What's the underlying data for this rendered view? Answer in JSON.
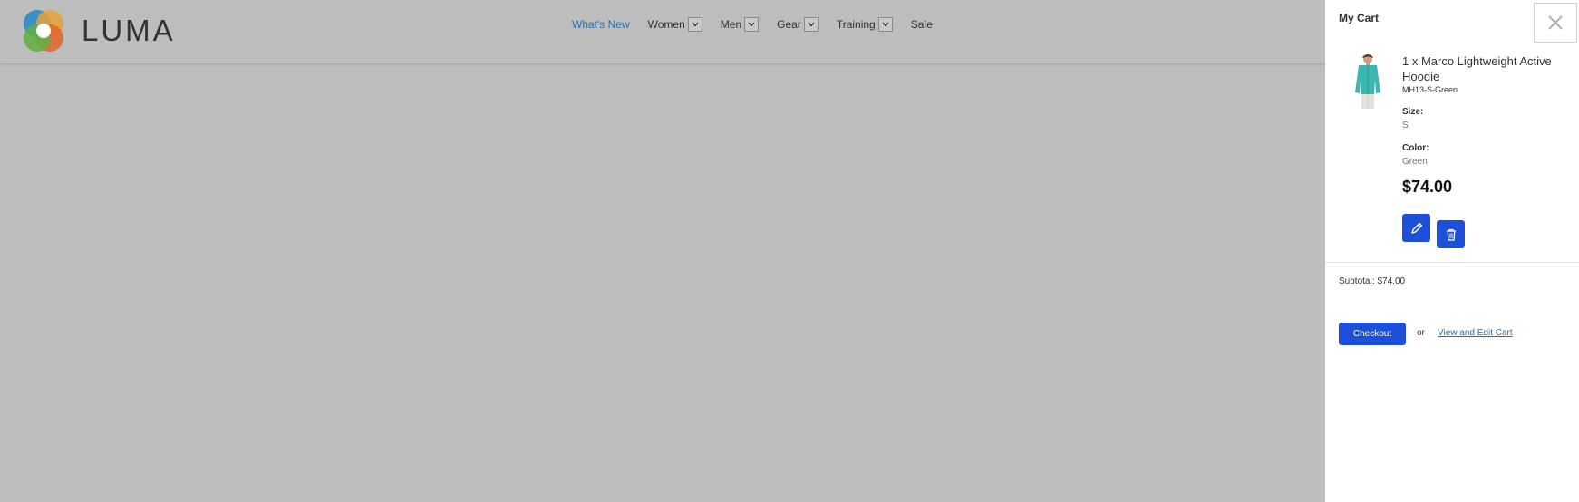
{
  "header": {
    "logo_text": "LUMA",
    "nav": [
      {
        "label": "What's New",
        "active": true,
        "has_dropdown": false
      },
      {
        "label": "Women",
        "has_dropdown": true
      },
      {
        "label": "Men",
        "has_dropdown": true
      },
      {
        "label": "Gear",
        "has_dropdown": true
      },
      {
        "label": "Training",
        "has_dropdown": true
      },
      {
        "label": "Sale",
        "has_dropdown": false
      }
    ]
  },
  "cart": {
    "title": "My Cart",
    "item": {
      "name": "1 x Marco Lightweight Active Hoodie",
      "sku": "MH13-S-Green",
      "size_label": "Size:",
      "size_value": "S",
      "color_label": "Color:",
      "color_value": "Green",
      "price": "$74.00"
    },
    "subtotal_label": "Subtotal:",
    "subtotal_value": "$74.00",
    "checkout_label": "Checkout",
    "or_text": "or",
    "view_edit_label": "View and Edit Cart"
  },
  "colors": {
    "overlay_bg": "#bdbdbd",
    "accent_blue": "#1d4fd8",
    "link_blue": "#1f6fb8",
    "hoodie_teal": "#3bb6b0"
  },
  "icons": [
    "luma-logo-icon",
    "chevron-down-icon",
    "close-icon",
    "pencil-icon",
    "trash-icon"
  ]
}
